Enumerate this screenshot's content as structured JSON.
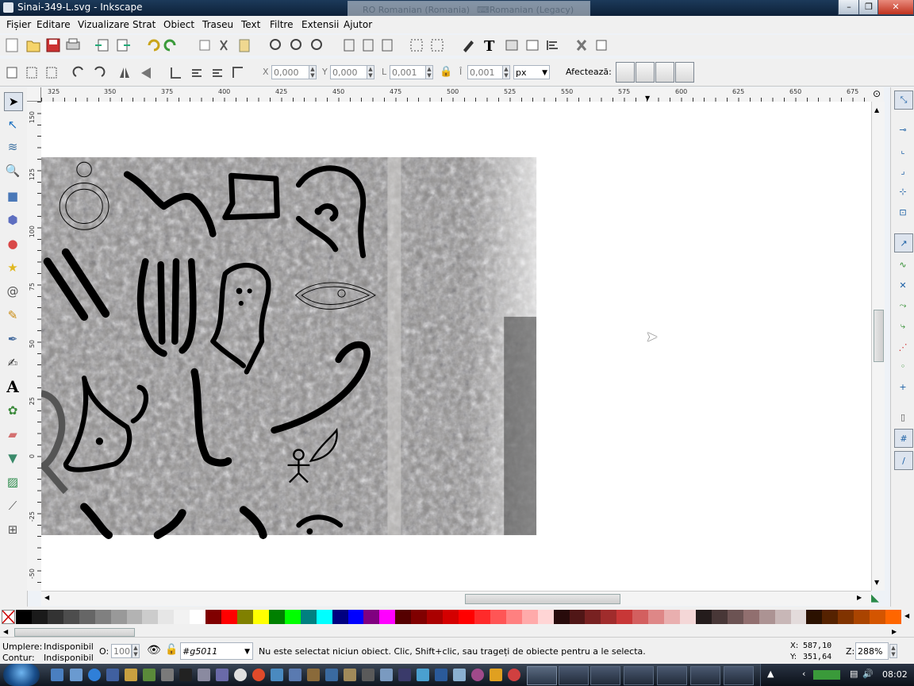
{
  "window": {
    "title": "Sinai-349-L.svg - Inkscape",
    "ime_language": "RO Romanian (Romania)",
    "ime_layout": "Romanian (Legacy)"
  },
  "menu": {
    "items": [
      "Fișier",
      "Editare",
      "Vizualizare",
      "Strat",
      "Obiect",
      "Traseu",
      "Text",
      "Filtre",
      "Extensii",
      "Ajutor"
    ]
  },
  "select_toolbar": {
    "x_label": "X",
    "x_value": "0,000",
    "y_label": "Y",
    "y_value": "0,000",
    "w_label": "L",
    "w_value": "0,001",
    "h_label": "Î",
    "h_value": "0,001",
    "unit": "px",
    "affect_label": "Afectează:"
  },
  "rulers": {
    "top_labels": [
      "325",
      "350",
      "375",
      "400",
      "425",
      "450",
      "475",
      "500",
      "525",
      "550",
      "575",
      "600",
      "625",
      "650",
      "675"
    ],
    "left_labels": [
      "150",
      "125",
      "100",
      "75",
      "50",
      "25",
      "0",
      "-25",
      "-50"
    ]
  },
  "status": {
    "fill_label": "Umplere:",
    "fill_value": "Indisponibil",
    "stroke_label": "Contur:",
    "stroke_value": "Indisponibil",
    "opacity_label": "O:",
    "opacity_value": "100",
    "layer_value": "#g5011",
    "message": "Nu este selectat niciun obiect. Clic, Shift+clic, sau trageți de obiecte pentru a le selecta.",
    "x_label": "X:",
    "x_coord": "587,10",
    "y_label": "Y:",
    "y_coord": "351,64",
    "zoom_label": "Z:",
    "zoom_value": "288%"
  },
  "taskbar": {
    "clock": "08:02"
  },
  "colors": {
    "palette": [
      "#000000",
      "#1a1a1a",
      "#333333",
      "#4d4d4d",
      "#666666",
      "#808080",
      "#999999",
      "#b3b3b3",
      "#cccccc",
      "#e6e6e6",
      "#f2f2f2",
      "#ffffff",
      "#800000",
      "#ff0000",
      "#808000",
      "#ffff00",
      "#008000",
      "#00ff00",
      "#008080",
      "#00ffff",
      "#000080",
      "#0000ff",
      "#800080",
      "#ff00ff",
      "#550000",
      "#800000",
      "#aa0000",
      "#d40000",
      "#ff0000",
      "#ff2a2a",
      "#ff5555",
      "#ff8080",
      "#ffaaaa",
      "#ffd5d5",
      "#280b0b",
      "#501616",
      "#782121",
      "#a02c2c",
      "#c83737",
      "#d35f5f",
      "#de8787",
      "#e9afaf",
      "#f4d7d7",
      "#241c1c",
      "#483737",
      "#6c5353",
      "#916f6f",
      "#ac9393",
      "#c8b7b7",
      "#e3dbdb",
      "#2b1100",
      "#552200",
      "#803300",
      "#aa4400",
      "#d45500",
      "#ff6600"
    ]
  }
}
